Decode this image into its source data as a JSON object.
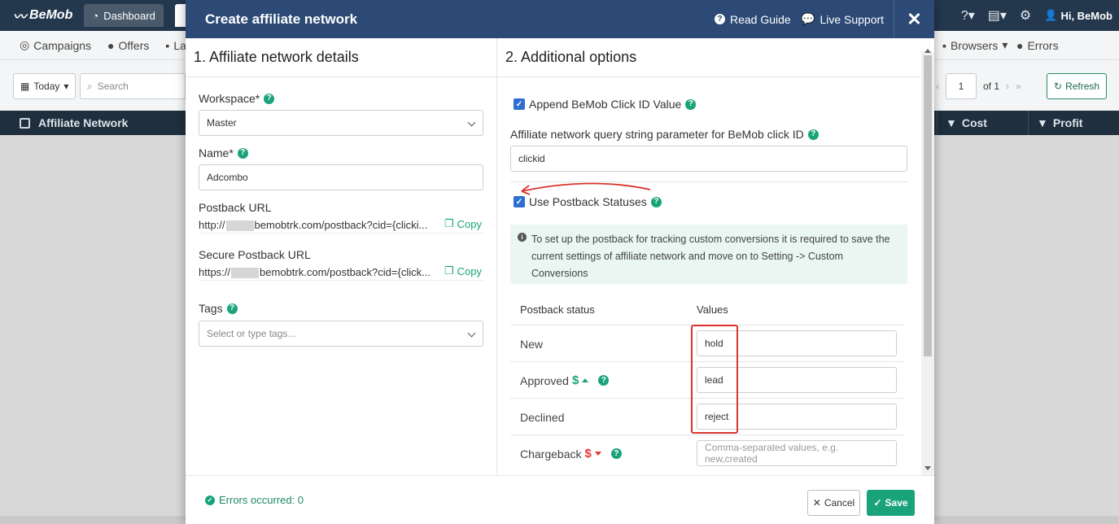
{
  "app": {
    "logo": "BeMob",
    "top_tabs": [
      {
        "label": "Dashboard"
      }
    ],
    "user_greeting": "Hi, BeMob",
    "subnav": [
      {
        "label": "Campaigns"
      },
      {
        "label": "Offers"
      },
      {
        "label": "La"
      },
      {
        "label": "Browsers"
      },
      {
        "label": "Errors"
      }
    ],
    "toolbar": {
      "date_range": "Today",
      "search_placeholder": "Search",
      "page_value": "1",
      "page_total": "of 1",
      "refresh_label": "Refresh"
    },
    "table_headers": [
      "Affiliate Network",
      "Cost",
      "Profit"
    ]
  },
  "modal": {
    "title": "Create affiliate network",
    "read_guide": "Read Guide",
    "live_support": "Live Support",
    "close": "✕",
    "left": {
      "section_title": "1. Affiliate network details",
      "workspace_label": "Workspace*",
      "workspace_value": "Master",
      "name_label": "Name*",
      "name_value": "Adcombo",
      "postback_label": "Postback URL",
      "postback_prefix": "http://",
      "postback_suffix": "bemobtrk.com/postback?cid={clicki...",
      "secure_postback_label": "Secure Postback URL",
      "secure_prefix": "https://",
      "secure_suffix": "bemobtrk.com/postback?cid={click...",
      "copy_label": "Copy",
      "tags_label": "Tags",
      "tags_placeholder": "Select or type tags..."
    },
    "right": {
      "section_title": "2. Additional options",
      "append_label": "Append BeMob Click ID Value",
      "query_param_label": "Affiliate network query string parameter for BeMob click ID",
      "query_param_value": "clickid",
      "use_statuses_label": "Use Postback Statuses",
      "info_text": "To set up the postback for tracking custom conversions it is required to save the current settings of affiliate network and move on to Setting -> Custom Conversions",
      "col_status": "Postback status",
      "col_values": "Values",
      "rows": [
        {
          "status": "New",
          "value": "hold",
          "placeholder": ""
        },
        {
          "status": "Approved",
          "value": "lead",
          "placeholder": ""
        },
        {
          "status": "Declined",
          "value": "reject",
          "placeholder": ""
        },
        {
          "status": "Chargeback",
          "value": "",
          "placeholder": "Comma-separated values, e.g. new,created"
        }
      ]
    },
    "footer": {
      "errors_text": "Errors occurred: 0",
      "cancel_label": "Cancel",
      "save_label": "Save"
    }
  },
  "colors": {
    "header_blue": "#2c4a75",
    "accent_green": "#1aa37a",
    "checkbox_blue": "#2f6fd1",
    "highlight_red": "#d9352f"
  }
}
